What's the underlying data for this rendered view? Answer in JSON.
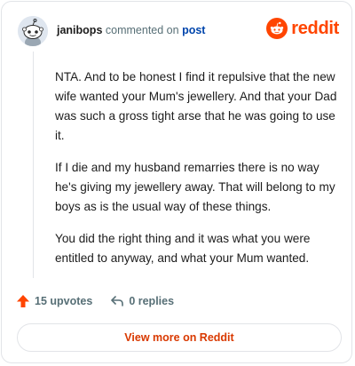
{
  "header": {
    "username": "janibops",
    "action_text": "commented on",
    "post_link": "post",
    "brand": "reddit"
  },
  "comment": {
    "paragraphs": [
      "NTA. And to be honest I find it repulsive that the new wife wanted your Mum's jewellery. And that your Dad was such a gross tight arse that he was going to use it.",
      "If I die and my husband remarries there is no way he's giving my jewellery away. That will belong to my boys as is the usual way of these things.",
      "You did the right thing and it was what you were entitled to anyway, and what your Mum wanted."
    ]
  },
  "actions": {
    "upvotes": "15 upvotes",
    "replies": "0 replies"
  },
  "footer": {
    "view_more_label": "View more on Reddit"
  },
  "colors": {
    "brand": "#ff4500",
    "link": "#0045ac",
    "view_more": "#d93900",
    "muted": "#576f76"
  },
  "icons": {
    "avatar": "snoo-avatar-icon",
    "brand": "reddit-logo-icon",
    "upvote": "upvote-arrow-icon",
    "reply": "reply-icon"
  }
}
